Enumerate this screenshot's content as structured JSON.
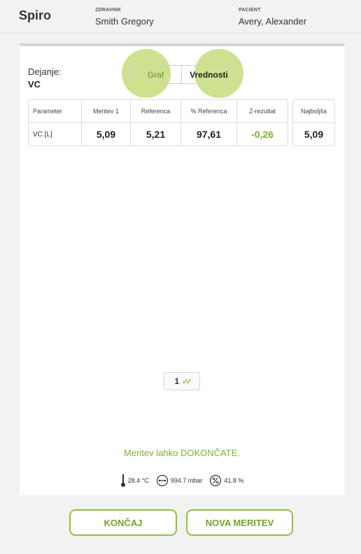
{
  "header": {
    "app_title": "Spiro",
    "doctor_label": "ZDRAVNIK",
    "doctor_name": "Smith Gregory",
    "patient_label": "PACIENT",
    "patient_name": "Avery, Alexander"
  },
  "card": {
    "action_label": "Dejanje:",
    "action_value": "VC",
    "view_toggle": {
      "options": [
        "Graf",
        "Vrednosti"
      ],
      "selected": "Vrednosti"
    },
    "table": {
      "headers": [
        "Parameter",
        "Meritev 1",
        "Referenca",
        "% Referenca",
        "Z-rezultat"
      ],
      "rows": [
        {
          "parameter": "VC [L]",
          "meritev_1": "5,09",
          "referenca": "5,21",
          "pct_referenca": "97,61",
          "z_rezultat": "-0,26"
        }
      ]
    },
    "best": {
      "header": "Najboljša",
      "value": "5,09"
    },
    "page_indicator": {
      "number": "1",
      "icon": "double-check-icon"
    },
    "status_message": "Meritev lahko DOKONČATE.",
    "environment": {
      "temperature": "28.4 °C",
      "pressure": "994.7 mbar",
      "humidity": "41.8 %"
    }
  },
  "buttons": {
    "finish_label": "KONČAJ",
    "new_measurement_label": "NOVA MERITEV"
  },
  "colors": {
    "accent_green": "#7ab32e",
    "halo_green": "#c6dc7c",
    "button_border": "#8fc33a"
  }
}
